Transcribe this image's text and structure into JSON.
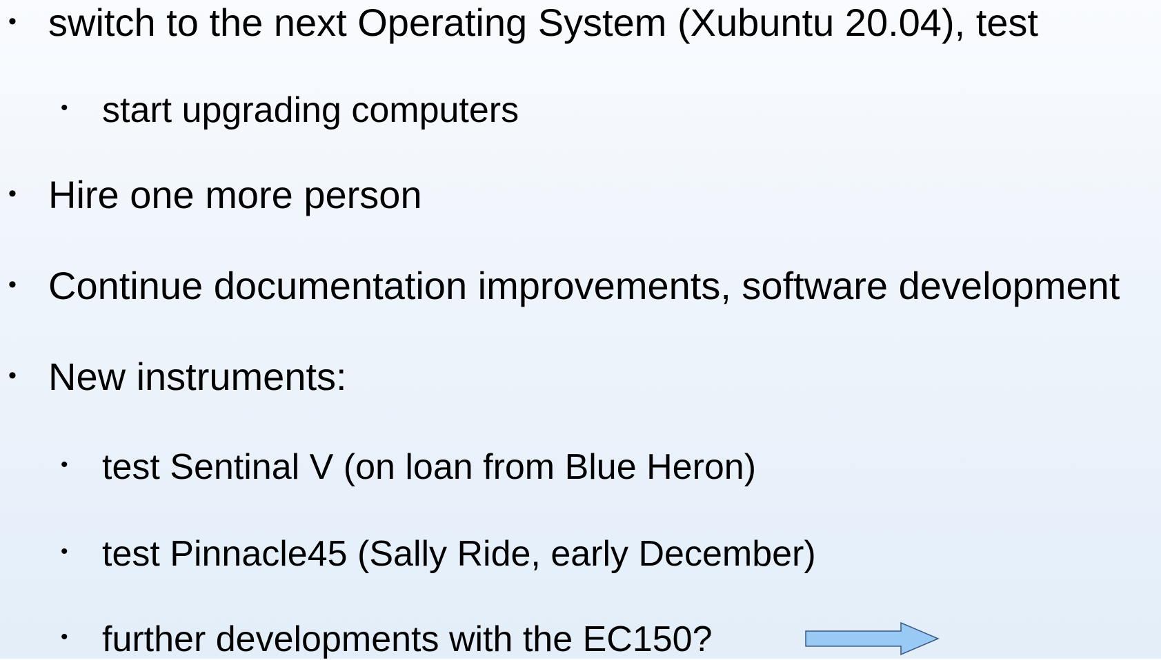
{
  "slide": {
    "bullet_glyph": "•",
    "items": [
      {
        "level": 1,
        "text": "switch to the next Operating System (Xubuntu 20.04), test"
      },
      {
        "level": 2,
        "text": "start upgrading computers"
      },
      {
        "level": 1,
        "text": "Hire one more person"
      },
      {
        "level": 1,
        "text": "Continue documentation improvements, software development"
      },
      {
        "level": 1,
        "text": "New instruments:"
      },
      {
        "level": 2,
        "text": "test Sentinal V (on loan from Blue Heron)"
      },
      {
        "level": 2,
        "text": "test Pinnacle45 (Sally Ride, early December)"
      },
      {
        "level": 2,
        "text": "further developments with the EC150?"
      }
    ],
    "arrow": {
      "icon": "right-arrow-icon",
      "fill": "#99c9f5",
      "stroke": "#3c5a80"
    }
  }
}
